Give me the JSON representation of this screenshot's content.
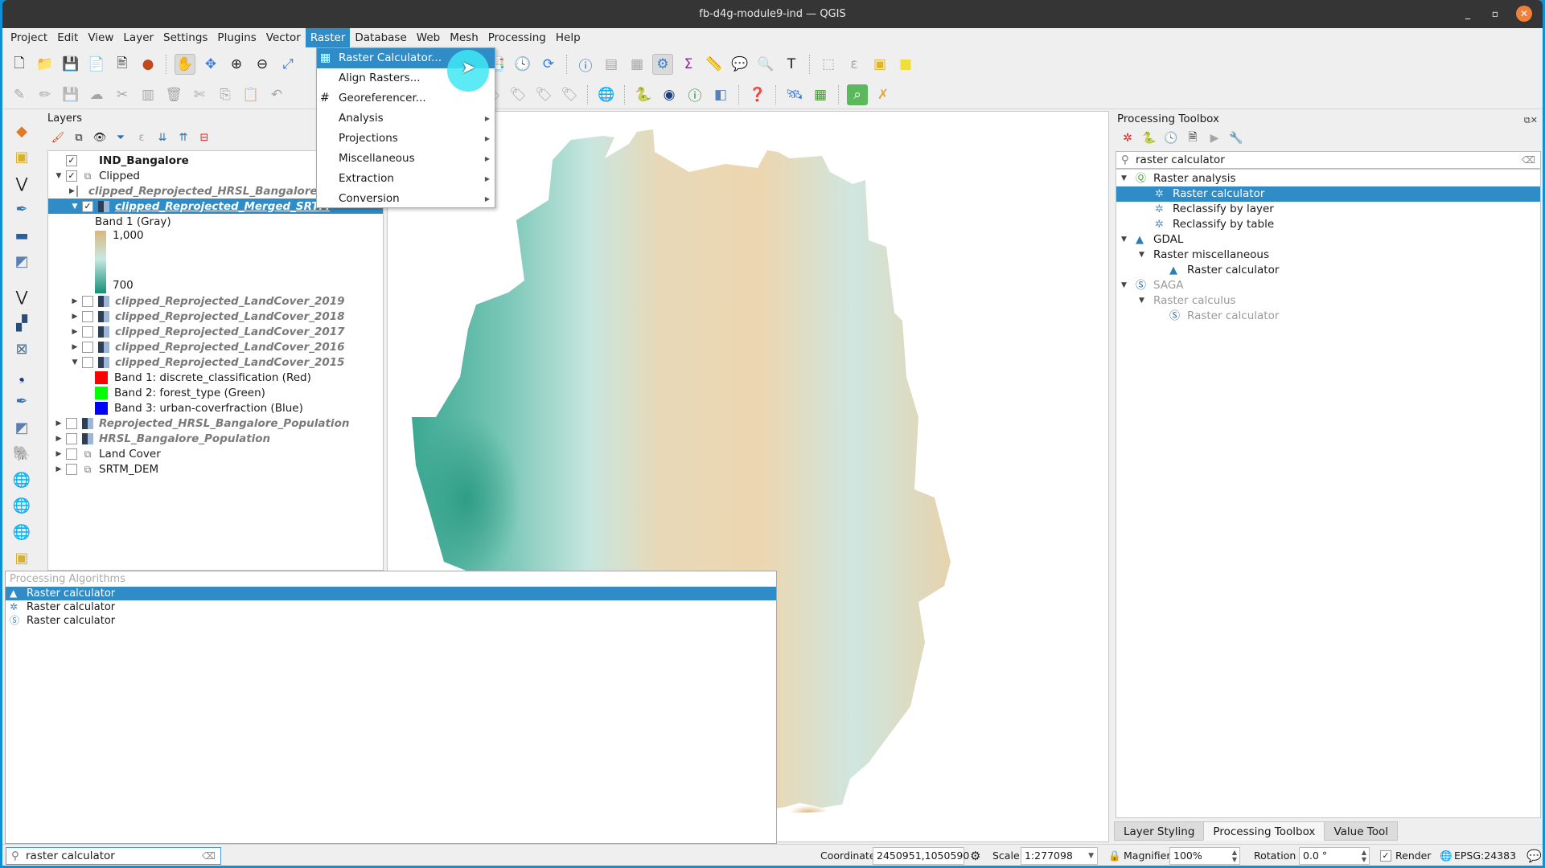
{
  "window": {
    "title": "fb-d4g-module9-ind — QGIS",
    "controls": {
      "minimize": "_",
      "maximize": "▫",
      "close": "✕"
    }
  },
  "menubar": {
    "items": [
      "Project",
      "Edit",
      "View",
      "Layer",
      "Settings",
      "Plugins",
      "Vector",
      "Raster",
      "Database",
      "Web",
      "Mesh",
      "Processing",
      "Help"
    ],
    "active": "Raster"
  },
  "raster_menu": {
    "items": [
      {
        "label": "Raster Calculator...",
        "icon": "raster-calculator-icon",
        "submenu": false,
        "highlighted": true
      },
      {
        "label": "Align Rasters...",
        "icon": "",
        "submenu": false
      },
      {
        "label": "Georeferencer...",
        "icon": "georeferencer-icon",
        "submenu": false
      },
      {
        "label": "Analysis",
        "icon": "",
        "submenu": true
      },
      {
        "label": "Projections",
        "icon": "",
        "submenu": true
      },
      {
        "label": "Miscellaneous",
        "icon": "",
        "submenu": true
      },
      {
        "label": "Extraction",
        "icon": "",
        "submenu": true
      },
      {
        "label": "Conversion",
        "icon": "",
        "submenu": true
      }
    ]
  },
  "layers_panel": {
    "title": "Layers",
    "layers": [
      {
        "name": "IND_Bangalore",
        "checked": true,
        "style": "bold",
        "expander": "",
        "icon": "none",
        "indent": 0
      },
      {
        "name": "Clipped",
        "checked": true,
        "style": "normal",
        "expander": "down",
        "icon": "group",
        "indent": 0
      },
      {
        "name": "clipped_Reprojected_HRSL_Bangalore_Population",
        "checked": false,
        "style": "italic",
        "expander": "right",
        "icon": "raster",
        "indent": 1
      },
      {
        "name": "clipped_Reprojected_Merged_SRTM",
        "checked": true,
        "style": "italic",
        "expander": "down",
        "icon": "raster",
        "indent": 1,
        "selected": true
      },
      {
        "name": "clipped_Reprojected_LandCover_2019",
        "checked": false,
        "style": "italic",
        "expander": "right",
        "icon": "raster",
        "indent": 1
      },
      {
        "name": "clipped_Reprojected_LandCover_2018",
        "checked": false,
        "style": "italic",
        "expander": "right",
        "icon": "raster",
        "indent": 1
      },
      {
        "name": "clipped_Reprojected_LandCover_2017",
        "checked": false,
        "style": "italic",
        "expander": "right",
        "icon": "raster",
        "indent": 1
      },
      {
        "name": "clipped_Reprojected_LandCover_2016",
        "checked": false,
        "style": "italic",
        "expander": "right",
        "icon": "raster",
        "indent": 1
      },
      {
        "name": "clipped_Reprojected_LandCover_2015",
        "checked": false,
        "style": "italic",
        "expander": "down",
        "icon": "raster",
        "indent": 1
      },
      {
        "name": "Reprojected_HRSL_Bangalore_Population",
        "checked": false,
        "style": "italic",
        "expander": "right",
        "icon": "raster",
        "indent": 0
      },
      {
        "name": "HRSL_Bangalore_Population",
        "checked": false,
        "style": "italic",
        "expander": "right",
        "icon": "raster",
        "indent": 0
      },
      {
        "name": "Land Cover",
        "checked": false,
        "style": "normal",
        "expander": "right",
        "icon": "group",
        "indent": 0
      },
      {
        "name": "SRTM_DEM",
        "checked": false,
        "style": "normal",
        "expander": "right",
        "icon": "group",
        "indent": 0
      }
    ],
    "srtm_legend": {
      "band": "Band 1 (Gray)",
      "max": "1,000",
      "min": "700",
      "color_max": "#d9b77d",
      "color_mid": "#c8e8e2",
      "color_min": "#139078"
    },
    "landcover_legend": [
      {
        "label": "Band 1: discrete_classification (Red)",
        "color": "#ff0000"
      },
      {
        "label": "Band 2: forest_type (Green)",
        "color": "#00ff00"
      },
      {
        "label": "Band 3: urban-coverfraction (Blue)",
        "color": "#0000ff"
      }
    ]
  },
  "locator_popup": {
    "header": "Processing Algorithms",
    "results": [
      {
        "label": "Raster calculator",
        "provider": "GDAL",
        "selected": true
      },
      {
        "label": "Raster calculator",
        "provider": "QGIS"
      },
      {
        "label": "Raster calculator",
        "provider": "SAGA"
      }
    ]
  },
  "locator_search": {
    "value": "raster calculator"
  },
  "processing_toolbox": {
    "title": "Processing Toolbox",
    "search_value": "raster calculator",
    "tree": [
      {
        "label": "Raster analysis",
        "level": 0,
        "expander": true,
        "icon": "qgis"
      },
      {
        "label": "Raster calculator",
        "level": 1,
        "icon": "gear",
        "selected": true
      },
      {
        "label": "Reclassify by layer",
        "level": 1,
        "icon": "gear"
      },
      {
        "label": "Reclassify by table",
        "level": 1,
        "icon": "gear"
      },
      {
        "label": "GDAL",
        "level": 0,
        "expander": true,
        "icon": "gdal"
      },
      {
        "label": "Raster miscellaneous",
        "level": 1,
        "expander": true,
        "icon": ""
      },
      {
        "label": "Raster calculator",
        "level": 2,
        "icon": "gdal"
      },
      {
        "label": "SAGA",
        "level": 0,
        "expander": true,
        "icon": "saga",
        "disabled": true
      },
      {
        "label": "Raster calculus",
        "level": 1,
        "expander": true,
        "icon": "",
        "disabled": true
      },
      {
        "label": "Raster calculator",
        "level": 2,
        "icon": "saga",
        "disabled": true
      }
    ]
  },
  "dock_tabs": [
    {
      "label": "Layer Styling",
      "active": false
    },
    {
      "label": "Processing Toolbox",
      "active": true
    },
    {
      "label": "Value Tool",
      "active": false
    }
  ],
  "statusbar": {
    "coordinate_label": "Coordinate",
    "coordinate_value": "2450951,1050590",
    "scale_label": "Scale",
    "scale_value": "1:277098",
    "magnifier_label": "Magnifier",
    "magnifier_value": "100%",
    "rotation_label": "Rotation",
    "rotation_value": "0.0 °",
    "render_label": "Render",
    "render_checked": true,
    "crs": "EPSG:24383"
  },
  "colors": {
    "accent": "#308cc6",
    "titlebar": "#353535",
    "close": "#f0803a"
  }
}
